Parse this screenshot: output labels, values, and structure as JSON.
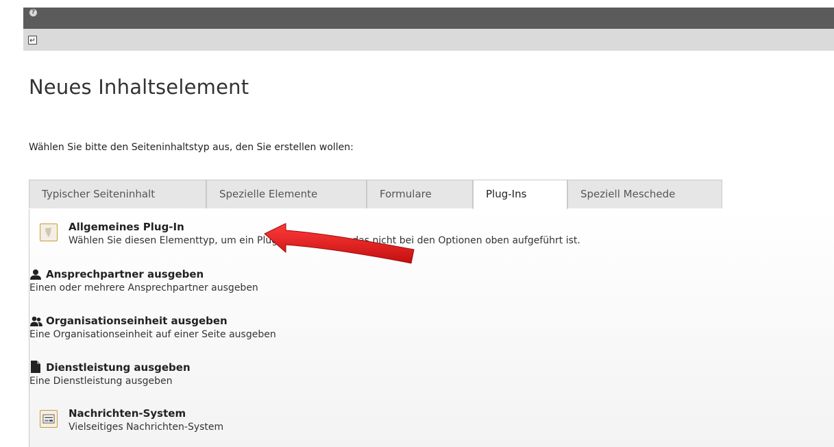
{
  "page": {
    "title": "Neues Inhaltselement",
    "intro": "Wählen Sie bitte den Seiteninhaltstyp aus, den Sie erstellen wollen:"
  },
  "toolbar": {
    "help_icon": "help-icon",
    "return_icon": "return-icon",
    "return_glyph": "↵"
  },
  "tabs": [
    {
      "label": "Typischer Seiteninhalt",
      "active": false
    },
    {
      "label": "Spezielle Elemente",
      "active": false
    },
    {
      "label": "Formulare",
      "active": false
    },
    {
      "label": "Plug-Ins",
      "active": true
    },
    {
      "label": "Speziell Meschede",
      "active": false
    }
  ],
  "items": [
    {
      "icon": "typo3-plugin-icon",
      "title": "Allgemeines Plug-In",
      "desc": "Wählen Sie diesen Elementtyp, um ein Plug-In einzufügen, das nicht bei den Optionen oben aufgeführt ist."
    },
    {
      "icon": "person-icon",
      "title": "Ansprechpartner ausgeben",
      "desc": "Einen oder mehrere Ansprechpartner ausgeben"
    },
    {
      "icon": "group-icon",
      "title": "Organisationseinheit ausgeben",
      "desc": "Eine Organisationseinheit auf einer Seite ausgeben"
    },
    {
      "icon": "document-icon",
      "title": "Dienstleistung ausgeben",
      "desc": "Eine Dienstleistung ausgeben"
    },
    {
      "icon": "news-icon",
      "title": "Nachrichten-System",
      "desc": "Vielseitiges Nachrichten-System"
    }
  ],
  "colors": {
    "arrow": "#e21b1b",
    "topbar": "#5b5b5b",
    "docbar": "#dadada"
  }
}
